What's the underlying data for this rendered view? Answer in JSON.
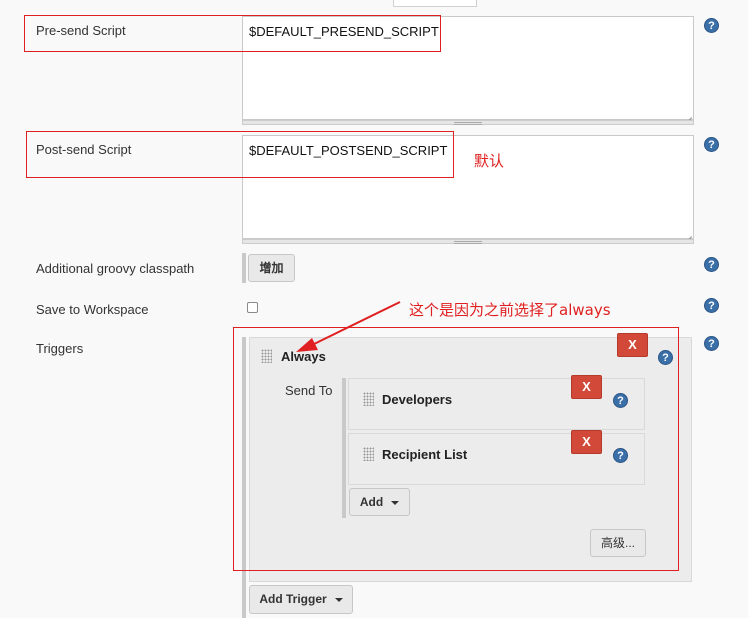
{
  "pre_send": {
    "label": "Pre-send Script",
    "value": "$DEFAULT_PRESEND_SCRIPT"
  },
  "post_send": {
    "label": "Post-send Script",
    "value": "$DEFAULT_POSTSEND_SCRIPT"
  },
  "groovy_classpath": {
    "label": "Additional groovy classpath",
    "add_button": "增加"
  },
  "save_to_workspace": {
    "label": "Save to Workspace",
    "checked": false
  },
  "triggers": {
    "label": "Triggers",
    "trigger_name": "Always",
    "send_to_label": "Send To",
    "recipients": [
      {
        "name": "Developers"
      },
      {
        "name": "Recipient List"
      }
    ],
    "add_button": "Add",
    "advanced_button": "高级...",
    "add_trigger_button": "Add Trigger",
    "delete_label": "X"
  },
  "help_icon_glyph": "?",
  "annotations": {
    "default_note": "默认",
    "always_note": "这个是因为之前选择了always",
    "color": "#e02020"
  }
}
